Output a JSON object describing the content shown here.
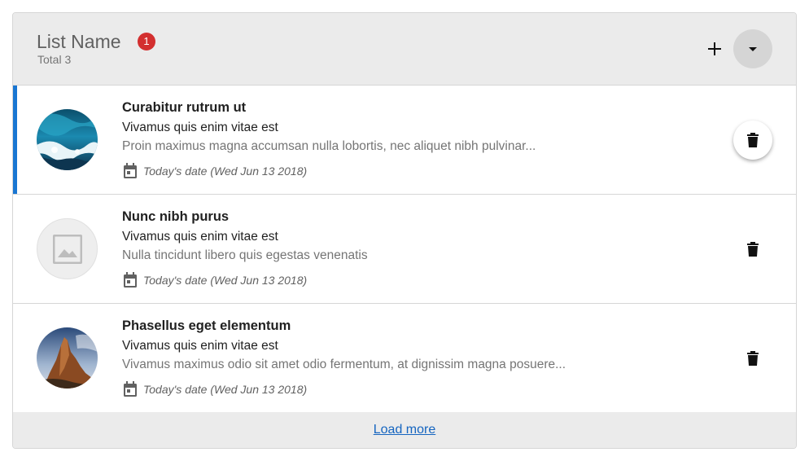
{
  "header": {
    "title": "List Name",
    "badge_count": "1",
    "subtitle": "Total 3",
    "add_icon": "plus-icon",
    "toggle_icon": "caret-down-icon",
    "badge_color": "#d32f2f"
  },
  "items": [
    {
      "title": "Curabitur rutrum ut",
      "line2": "Vivamus quis enim vitae est",
      "line3": "Proin maximus magna accumsan nulla lobortis, nec aliquet nibh pulvinar...",
      "date": "Today's date (Wed Jun 13 2018)",
      "avatar": "ocean-wave-image",
      "selected": true
    },
    {
      "title": "Nunc nibh purus",
      "line2": "Vivamus quis enim vitae est",
      "line3": "Nulla tincidunt libero quis egestas venenatis",
      "date": "Today's date (Wed Jun 13 2018)",
      "avatar": "image-placeholder-icon",
      "selected": false
    },
    {
      "title": "Phasellus eget elementum",
      "line2": "Vivamus quis enim vitae est",
      "line3": "Vivamus maximus odio sit amet odio fermentum, at dignissim magna posuere...",
      "date": "Today's date (Wed Jun 13 2018)",
      "avatar": "rock-mountain-image",
      "selected": false
    }
  ],
  "footer": {
    "load_more": "Load more",
    "link_color": "#1565c0"
  },
  "accent_color": "#1976d2"
}
